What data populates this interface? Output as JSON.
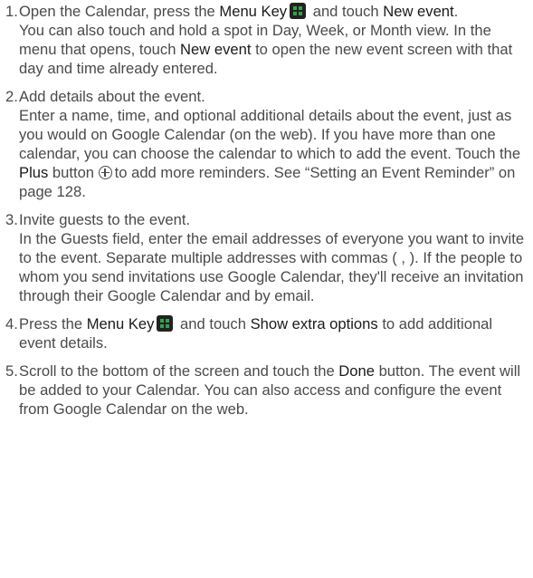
{
  "steps": [
    {
      "number": "1.",
      "text_a": "Open the Calendar, press the ",
      "bold_a": "Menu Key",
      "icon_a": "menu-key-icon",
      "text_b": " and touch ",
      "bold_b": "New event",
      "text_c": ".",
      "detail_a": "You can also touch and hold a spot in Day, Week, or Month view. In the menu that opens, touch ",
      "detail_bold": "New event",
      "detail_b": " to open the new event screen with that day and time already entered."
    },
    {
      "number": "2.",
      "title": "Add details about the event.",
      "detail_a": "Enter a name, time, and optional additional details about the event, just as you would on Google Calendar (on the web). If you have more than one calendar, you can choose the calendar to which to add the event. Touch the ",
      "detail_bold": "Plus",
      "detail_b": " button ",
      "icon": "plus-circle-icon",
      "detail_c": "to add more reminders. See “Setting an Event Reminder” on page 128."
    },
    {
      "number": "3.",
      "title": "Invite guests to the event.",
      "detail": "In the Guests field, enter the email addresses of everyone you want to invite to the event. Separate multiple addresses with commas ( , ). If the people to whom you send invitations use Google Calendar, they'll receive an invitation through their Google Calendar and by email."
    },
    {
      "number": "4.",
      "text_a": "Press the ",
      "bold_a": "Menu Key",
      "icon_a": "menu-key-icon",
      "text_b": " and touch ",
      "bold_b": "Show extra options",
      "text_c": " to add additional event details."
    },
    {
      "number": "5.",
      "text_a": "Scroll to the bottom of the screen and touch the ",
      "bold_a": "Done",
      "text_b": " button. The event will be added to your Calendar. You can also access and configure the event from Google Calendar on the web."
    }
  ]
}
